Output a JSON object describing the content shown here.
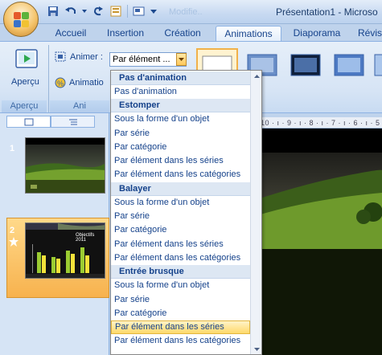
{
  "window": {
    "title": "Présentation1 - Microso",
    "ghost_title": "Modifie.. "
  },
  "tabs": [
    "Accueil",
    "Insertion",
    "Création",
    "Animations",
    "Diaporama",
    "Révis"
  ],
  "active_tab": "Animations",
  "ribbon": {
    "apercu_button": "Aperçu",
    "apercu_group": "Aperçu",
    "animer_label": "Animer :",
    "animer_value": "Par élément ...",
    "animations_label": "Animatio",
    "anim_group": "Ani"
  },
  "ruler_text": "10 · ı · 9 · ı · 8 · ı · 7 · ı · 6 · ı · 5",
  "slides": [
    {
      "number": "1"
    },
    {
      "number": "2",
      "chart_title": "Objectifs 2011"
    }
  ],
  "dropdown": {
    "groups": [
      {
        "header": "Pas d'animation",
        "items": [
          "Pas d'animation"
        ]
      },
      {
        "header": "Estomper",
        "items": [
          "Sous la forme d'un objet",
          "Par série",
          "Par catégorie",
          "Par élément dans les séries",
          "Par élément dans les catégories"
        ]
      },
      {
        "header": "Balayer",
        "items": [
          "Sous la forme d'un objet",
          "Par série",
          "Par catégorie",
          "Par élément dans les séries",
          "Par élément dans les catégories"
        ]
      },
      {
        "header": "Entrée brusque",
        "items": [
          "Sous la forme d'un objet",
          "Par série",
          "Par catégorie",
          "Par élément dans les séries",
          "Par élément dans les catégories"
        ]
      }
    ],
    "highlighted": "Entrée brusque / Par élément dans les séries"
  },
  "colors": {
    "accent": "#15428b",
    "highlight": "#ffd96b",
    "office_orange": "#f4c36a"
  }
}
